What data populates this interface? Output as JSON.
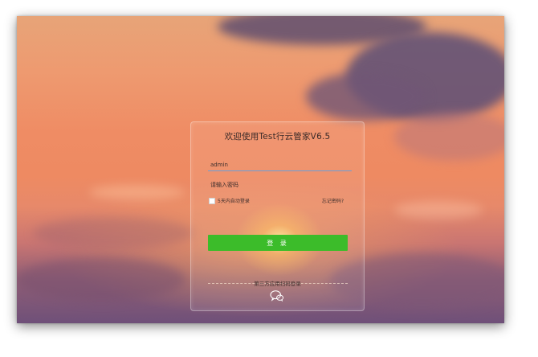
{
  "login": {
    "title": "欢迎使用Test行云管家V6.5",
    "username_value": "admin",
    "password_placeholder": "请输入密码",
    "remember_label": "5天内自动登录",
    "forgot_label": "忘记密码?",
    "submit_label": "登 录",
    "third_party_label": "第三方应用扫码登录",
    "third_party_icon": "wechat-icon",
    "submit_color": "#3cbc2a"
  }
}
